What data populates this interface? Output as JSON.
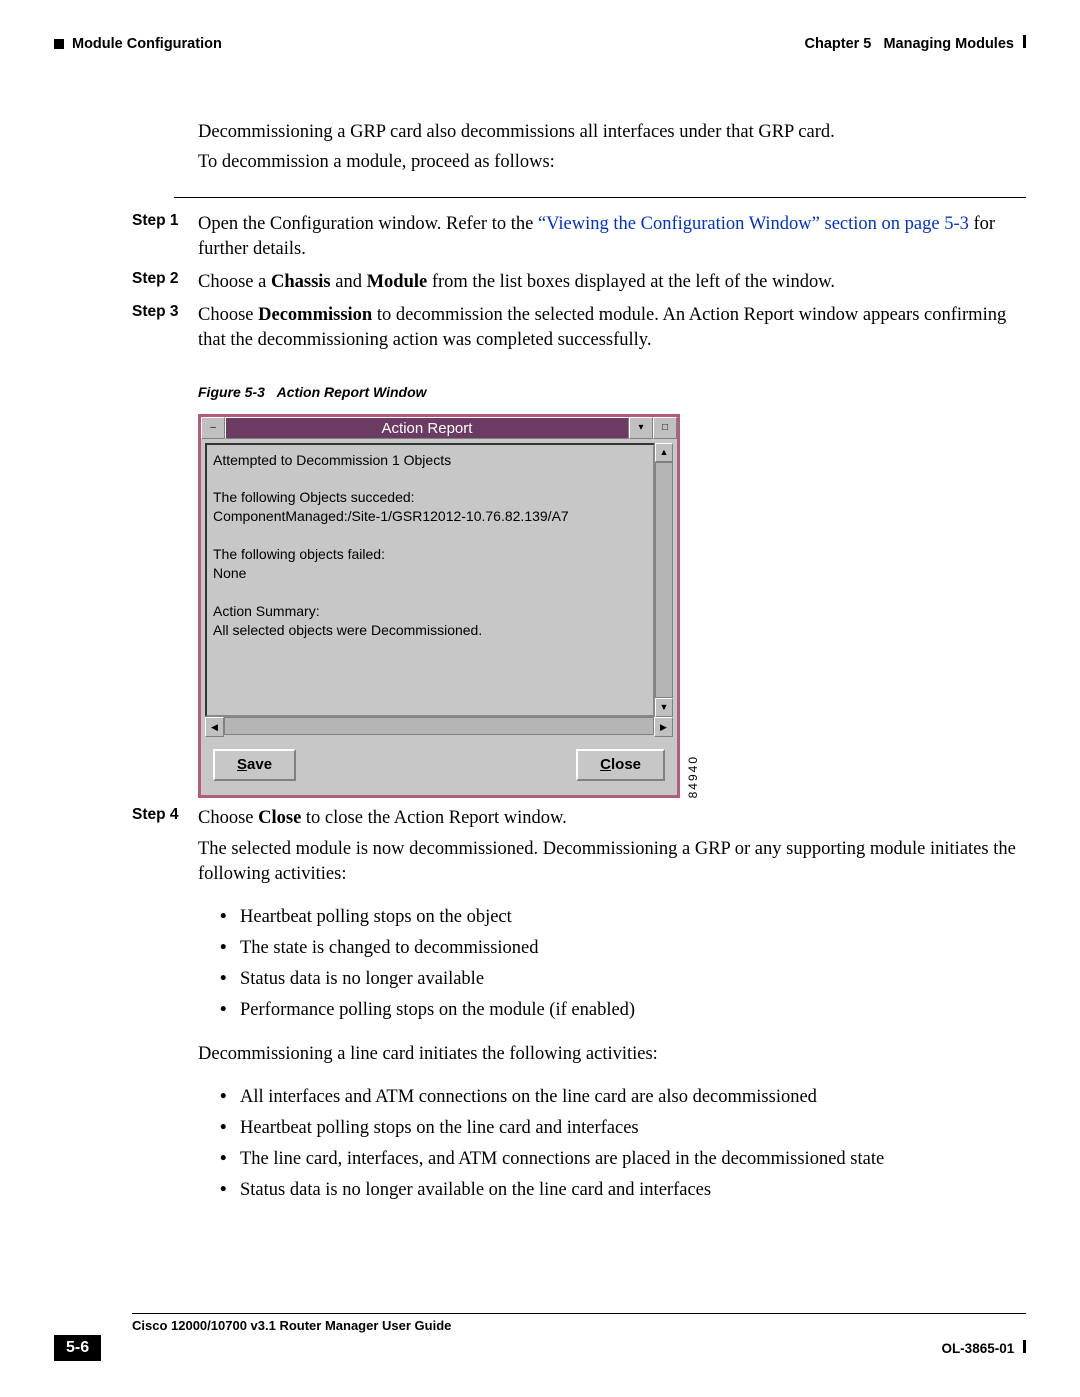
{
  "header": {
    "left": "Module Configuration",
    "right_prefix": "Chapter 5",
    "right_title": "Managing Modules"
  },
  "intro": {
    "p1": "Decommissioning a GRP card also decommissions all interfaces under that GRP card.",
    "p2": "To decommission a module, proceed as follows:"
  },
  "steps": {
    "s1": {
      "label": "Step 1",
      "pre": "Open the Configuration window. Refer to the ",
      "link": "“Viewing the Configuration Window” section on page 5-3",
      "post": " for further details."
    },
    "s2": {
      "label": "Step 2",
      "pre": "Choose a ",
      "b1": "Chassis",
      "mid": " and ",
      "b2": "Module",
      "post": " from the list boxes displayed at the left of the window."
    },
    "s3": {
      "label": "Step 3",
      "pre": "Choose ",
      "b": "Decommission",
      "post": " to decommission the selected module. An Action Report window appears confirming that the decommissioning action was completed successfully."
    },
    "s4": {
      "label": "Step 4",
      "pre": "Choose ",
      "b": "Close",
      "post": " to close the Action Report window.",
      "p2": "The selected module is now decommissioned. Decommissioning a GRP or any supporting module initiates the following activities:",
      "bul1": [
        "Heartbeat polling stops on the object",
        "The state is changed to decommissioned",
        "Status data is no longer available",
        "Performance polling stops on the module (if enabled)"
      ],
      "p3": "Decommissioning a line card initiates the following activities:",
      "bul2": [
        "All interfaces and ATM connections on the line card are also decommissioned",
        "Heartbeat polling stops on the line card and interfaces",
        "The line card, interfaces, and ATM connections are placed in the decommissioned state",
        "Status data is no longer available on the line card and interfaces"
      ]
    }
  },
  "figure": {
    "caption_num": "Figure 5-3",
    "caption_title": "Action Report Window",
    "image_id": "84940"
  },
  "window": {
    "title": "Action Report",
    "text": "Attempted to Decommission 1 Objects\n\nThe following Objects succeded:\nComponentManaged:/Site-1/GSR12012-10.76.82.139/A7\n\nThe following objects failed:\nNone\n\nAction Summary:\nAll selected objects were Decommissioned.",
    "save_u": "S",
    "save_rest": "ave",
    "close_u": "C",
    "close_rest": "lose"
  },
  "footer": {
    "guide": "Cisco 12000/10700 v3.1 Router Manager User Guide",
    "page": "5-6",
    "doc": "OL-3865-01"
  }
}
